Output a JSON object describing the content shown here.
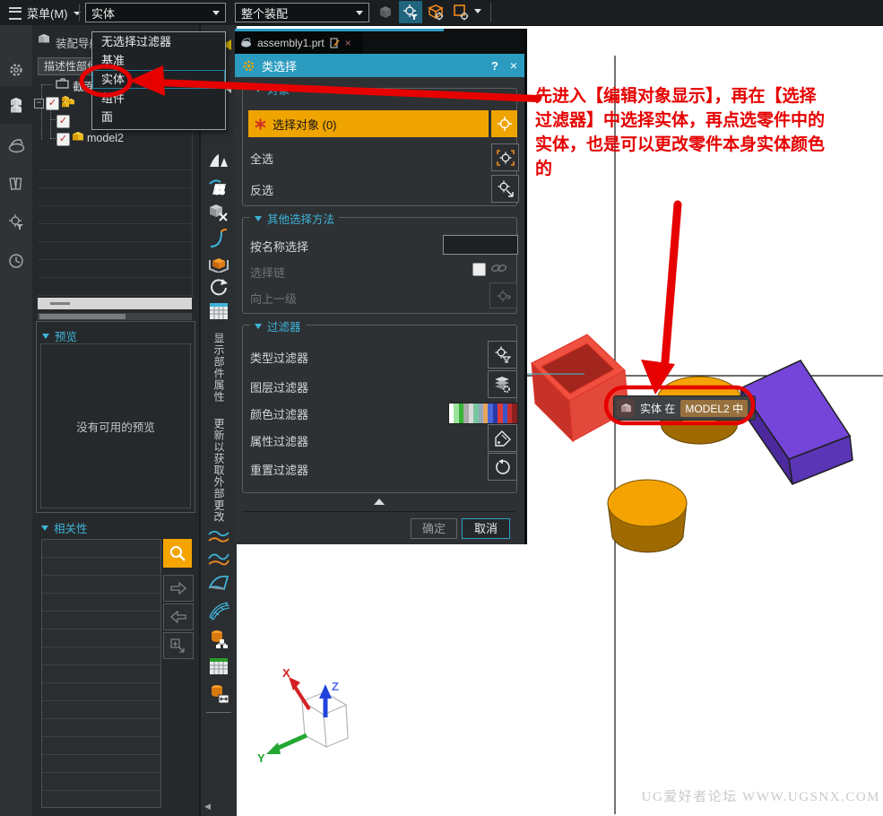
{
  "icons": {
    "caret_down": "▼",
    "check": "✓",
    "minus": "−",
    "close": "×",
    "help": "?",
    "collapse_up": "▲",
    "left_collapse": "◀"
  },
  "topbar": {
    "menu_label": "菜单(M)",
    "selection_filter": "实体",
    "selection_scope": "整个装配"
  },
  "tab": {
    "title": "assembly1.prt"
  },
  "filter_dropdown": {
    "items": [
      "无选择过滤器",
      "基准",
      "实体",
      "组件",
      "面"
    ],
    "selected_index": 2
  },
  "navigator": {
    "title": "装配导航器",
    "column_header": "描述性部件名",
    "rows": [
      {
        "label": "截面"
      },
      {
        "label": ""
      },
      {
        "label": ""
      },
      {
        "label": "model2"
      }
    ]
  },
  "preview": {
    "title": "预览",
    "empty_text": "没有可用的预览"
  },
  "dependencies": {
    "title": "相关性"
  },
  "side_toolbar": {
    "vertical_label_1": "显示部件属性",
    "vertical_label_2": "更新以获取外部更改"
  },
  "dialog": {
    "title": "类选择",
    "objects_section": {
      "title": "对象",
      "select_object": "选择对象 (0)",
      "select_all": "全选",
      "invert_selection": "反选"
    },
    "other_section": {
      "title": "其他选择方法",
      "select_by_name": "按名称选择",
      "selection_chain": "选择链",
      "up_one_level": "向上一级"
    },
    "filter_section": {
      "title": "过滤器",
      "type_filter": "类型过滤器",
      "layer_filter": "图层过滤器",
      "color_filter": "颜色过滤器",
      "attribute_filter": "属性过滤器",
      "reset_filter": "重置过滤器",
      "color_swatch": [
        "#ffffff",
        "#9be49b",
        "#37b337",
        "#ababab",
        "#d9d9d9",
        "#79c7a2",
        "#8fa9bb",
        "#e6a55c",
        "#4a66d8",
        "#2a39a8",
        "#d83a3a",
        "#3a57c8",
        "#c62f2f",
        "#8c1f1f"
      ]
    },
    "footer": {
      "ok": "确定",
      "cancel": "取消"
    }
  },
  "viewport": {
    "annotation": {
      "lines": [
        "先进入【编辑对象显示】，再在【选择",
        "过滤器】中选择实体，再点选零件中的",
        "实体，也是可以更改零件本身实体颜色",
        "的"
      ],
      "color": "#e60000"
    },
    "tooltip": {
      "prefix": "实体 在",
      "highlight": "MODEL2 中"
    },
    "triad": {
      "x_label": "X",
      "y_label": "Y",
      "z_label": "Z"
    },
    "watermark": "UG爱好者论坛 WWW.UGSNX.COM",
    "solid_colors": {
      "red_box": "#f0503f",
      "purple_box": "#7445d8",
      "cylinder_top": "#f4a303",
      "cylinder_side": "#a06a03"
    }
  }
}
